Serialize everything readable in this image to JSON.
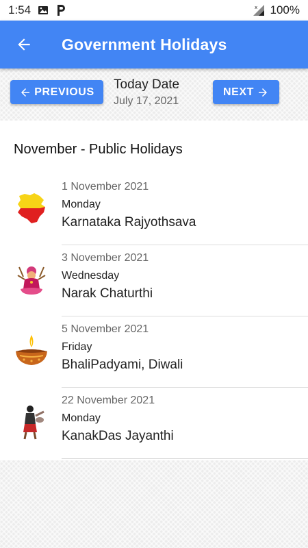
{
  "status_bar": {
    "time": "1:54",
    "battery": "100%"
  },
  "app_bar": {
    "title": "Government Holidays"
  },
  "date_nav": {
    "previous_label": "PREVIOUS",
    "next_label": "NEXT",
    "today_label": "Today Date",
    "today_value": "July 17, 2021"
  },
  "section_title": "November - Public Holidays",
  "holidays": [
    {
      "date": "1 November 2021",
      "day": "Monday",
      "name": "Karnataka Rajyothsava",
      "icon": "karnataka-map-icon"
    },
    {
      "date": "3 November 2021",
      "day": "Wednesday",
      "name": "Narak Chaturthi",
      "icon": "goddess-icon"
    },
    {
      "date": "5 November 2021",
      "day": "Friday",
      "name": "BhaliPadyami, Diwali",
      "icon": "diya-lamp-icon"
    },
    {
      "date": "22 November 2021",
      "day": "Monday",
      "name": "KanakDas Jayanthi",
      "icon": "saint-figure-icon"
    }
  ],
  "colors": {
    "primary": "#4285f4",
    "background": "#ececec"
  }
}
